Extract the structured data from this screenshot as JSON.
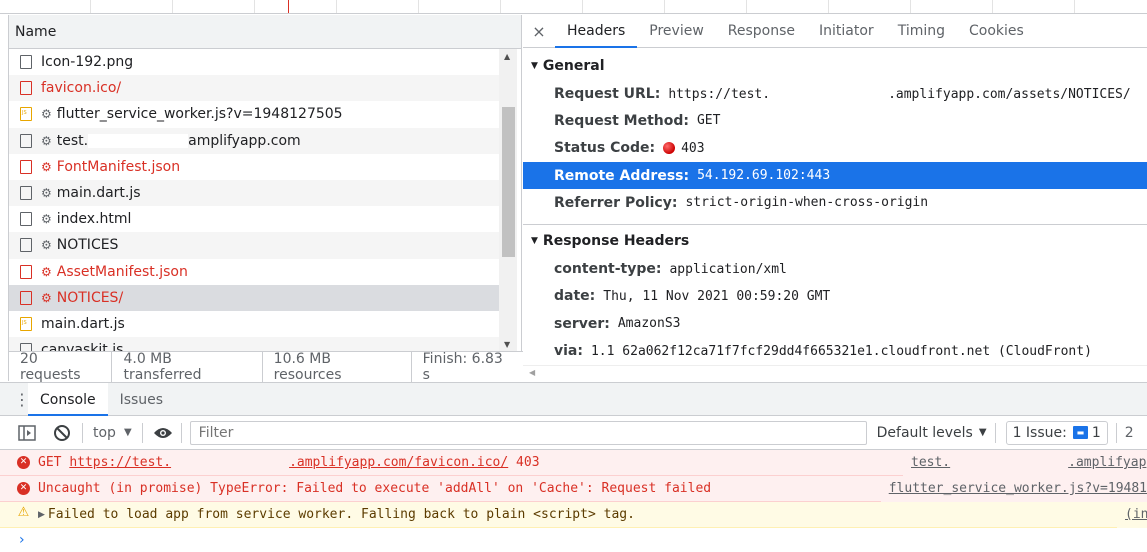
{
  "network": {
    "name_header": "Name",
    "requests": [
      {
        "name": "Icon-192.png",
        "kind": "file",
        "error": false,
        "gear": false,
        "selected": false
      },
      {
        "name": "favicon.ico/",
        "kind": "file",
        "error": true,
        "gear": false,
        "selected": false
      },
      {
        "name": "flutter_service_worker.js?v=1948127505",
        "kind": "script",
        "error": false,
        "gear": true,
        "selected": false
      },
      {
        "name": "test.",
        "name_suffix": "amplifyapp.com",
        "kind": "file",
        "error": false,
        "gear": true,
        "selected": false
      },
      {
        "name": "FontManifest.json",
        "kind": "file",
        "error": true,
        "gear": true,
        "selected": false
      },
      {
        "name": "main.dart.js",
        "kind": "file",
        "error": false,
        "gear": true,
        "selected": false
      },
      {
        "name": "index.html",
        "kind": "file",
        "error": false,
        "gear": true,
        "selected": false
      },
      {
        "name": "NOTICES",
        "kind": "file",
        "error": false,
        "gear": true,
        "selected": false
      },
      {
        "name": "AssetManifest.json",
        "kind": "file",
        "error": true,
        "gear": true,
        "selected": false
      },
      {
        "name": "NOTICES/",
        "kind": "file",
        "error": true,
        "gear": true,
        "selected": true
      },
      {
        "name": "main.dart.js",
        "kind": "script",
        "error": false,
        "gear": false,
        "selected": false
      },
      {
        "name": "canvaskit.js",
        "kind": "file",
        "error": false,
        "gear": false,
        "selected": false
      }
    ],
    "summary": {
      "requests": "20 requests",
      "transferred": "4.0 MB transferred",
      "resources": "10.6 MB resources",
      "finish": "Finish: 6.83 s"
    }
  },
  "detail": {
    "close": "×",
    "tabs": [
      "Headers",
      "Preview",
      "Response",
      "Initiator",
      "Timing",
      "Cookies"
    ],
    "active_tab": "Headers",
    "general": {
      "title": "General",
      "request_url_key": "Request URL:",
      "request_url_prefix": "https://test.",
      "request_url_suffix": ".amplifyapp.com/assets/NOTICES/",
      "request_method_key": "Request Method:",
      "request_method": "GET",
      "status_code_key": "Status Code:",
      "status_code": "403",
      "remote_address_key": "Remote Address:",
      "remote_address": "54.192.69.102:443",
      "referrer_policy_key": "Referrer Policy:",
      "referrer_policy": "strict-origin-when-cross-origin"
    },
    "response_headers": {
      "title": "Response Headers",
      "items": [
        {
          "key": "content-type:",
          "value": "application/xml"
        },
        {
          "key": "date:",
          "value": "Thu, 11 Nov 2021 00:59:20 GMT"
        },
        {
          "key": "server:",
          "value": "AmazonS3"
        },
        {
          "key": "via:",
          "value": "1.1 62a062f12ca71f7fcf29dd4f665321e1.cloudfront.net (CloudFront)"
        }
      ]
    }
  },
  "drawer": {
    "tabs": [
      "Console",
      "Issues"
    ],
    "active_tab": "Console",
    "toolbar": {
      "context": "top",
      "filter_placeholder": "Filter",
      "levels": "Default levels",
      "issues": "1 Issue:",
      "issue_count": "1",
      "extra": "2"
    },
    "messages": [
      {
        "level": "error",
        "prefix": "GET ",
        "url_start": "https://test.",
        "url_end": ".amplifyapp.com/favicon.ico/",
        "status": " 403",
        "source_start": "test.",
        "source_end": ".amplifyap"
      },
      {
        "level": "error",
        "text": "Uncaught (in promise) TypeError: Failed to execute 'addAll' on 'Cache': Request failed",
        "source": "flutter_service_worker.js?v=19481"
      },
      {
        "level": "warning",
        "text": "Failed to load app from service worker. Falling back to plain <script> tag.",
        "source": "(in"
      }
    ],
    "prompt": "›"
  },
  "colors": {
    "accent": "#1a73e8",
    "error": "#d93025",
    "warning": "#e8a600",
    "selected_row": "#dadce0"
  },
  "icons": [
    "close-icon",
    "gear-icon",
    "file-icon",
    "script-file-icon",
    "status-dot-icon",
    "kebab-menu-icon",
    "sidebar-toggle-icon",
    "clear-console-icon",
    "eye-icon",
    "dropdown-arrow-icon",
    "error-icon",
    "warning-icon",
    "issue-flag-icon"
  ]
}
